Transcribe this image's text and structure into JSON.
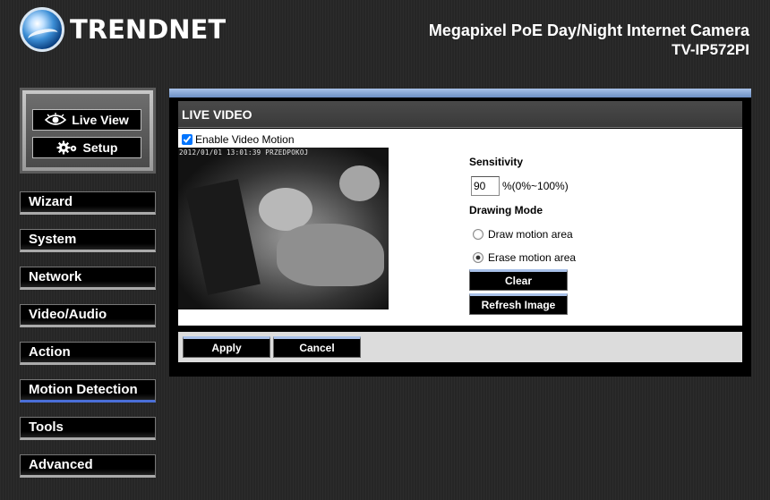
{
  "brand": {
    "name": "TRENDNET",
    "logo_icon": "globe-logo"
  },
  "header": {
    "product_name": "Megapixel PoE Day/Night Internet Camera",
    "model": "TV-IP572PI"
  },
  "mode_buttons": {
    "live_view": "Live View",
    "setup": "Setup"
  },
  "nav": [
    {
      "label": "Wizard"
    },
    {
      "label": "System"
    },
    {
      "label": "Network"
    },
    {
      "label": "Video/Audio"
    },
    {
      "label": "Action"
    },
    {
      "label": "Motion Detection"
    },
    {
      "label": "Tools"
    },
    {
      "label": "Advanced"
    }
  ],
  "panel": {
    "title": "LIVE VIDEO",
    "enable_label": "Enable Video Motion",
    "enable_checked": true,
    "osd_text": "2012/01/01 13:01:39 PRZEDPOKOJ",
    "sensitivity_label": "Sensitivity",
    "sensitivity_value": "90",
    "sensitivity_range": "%(0%~100%)",
    "drawing_mode_label": "Drawing Mode",
    "draw_option": "Draw motion area",
    "erase_option": "Erase motion area",
    "selected_mode": "erase",
    "clear_button": "Clear",
    "refresh_button": "Refresh Image",
    "apply_button": "Apply",
    "cancel_button": "Cancel"
  },
  "colors": {
    "accent_blue": "#a8c2e8",
    "active_underline": "#4a6fd8",
    "background": "#2a2a2a"
  }
}
